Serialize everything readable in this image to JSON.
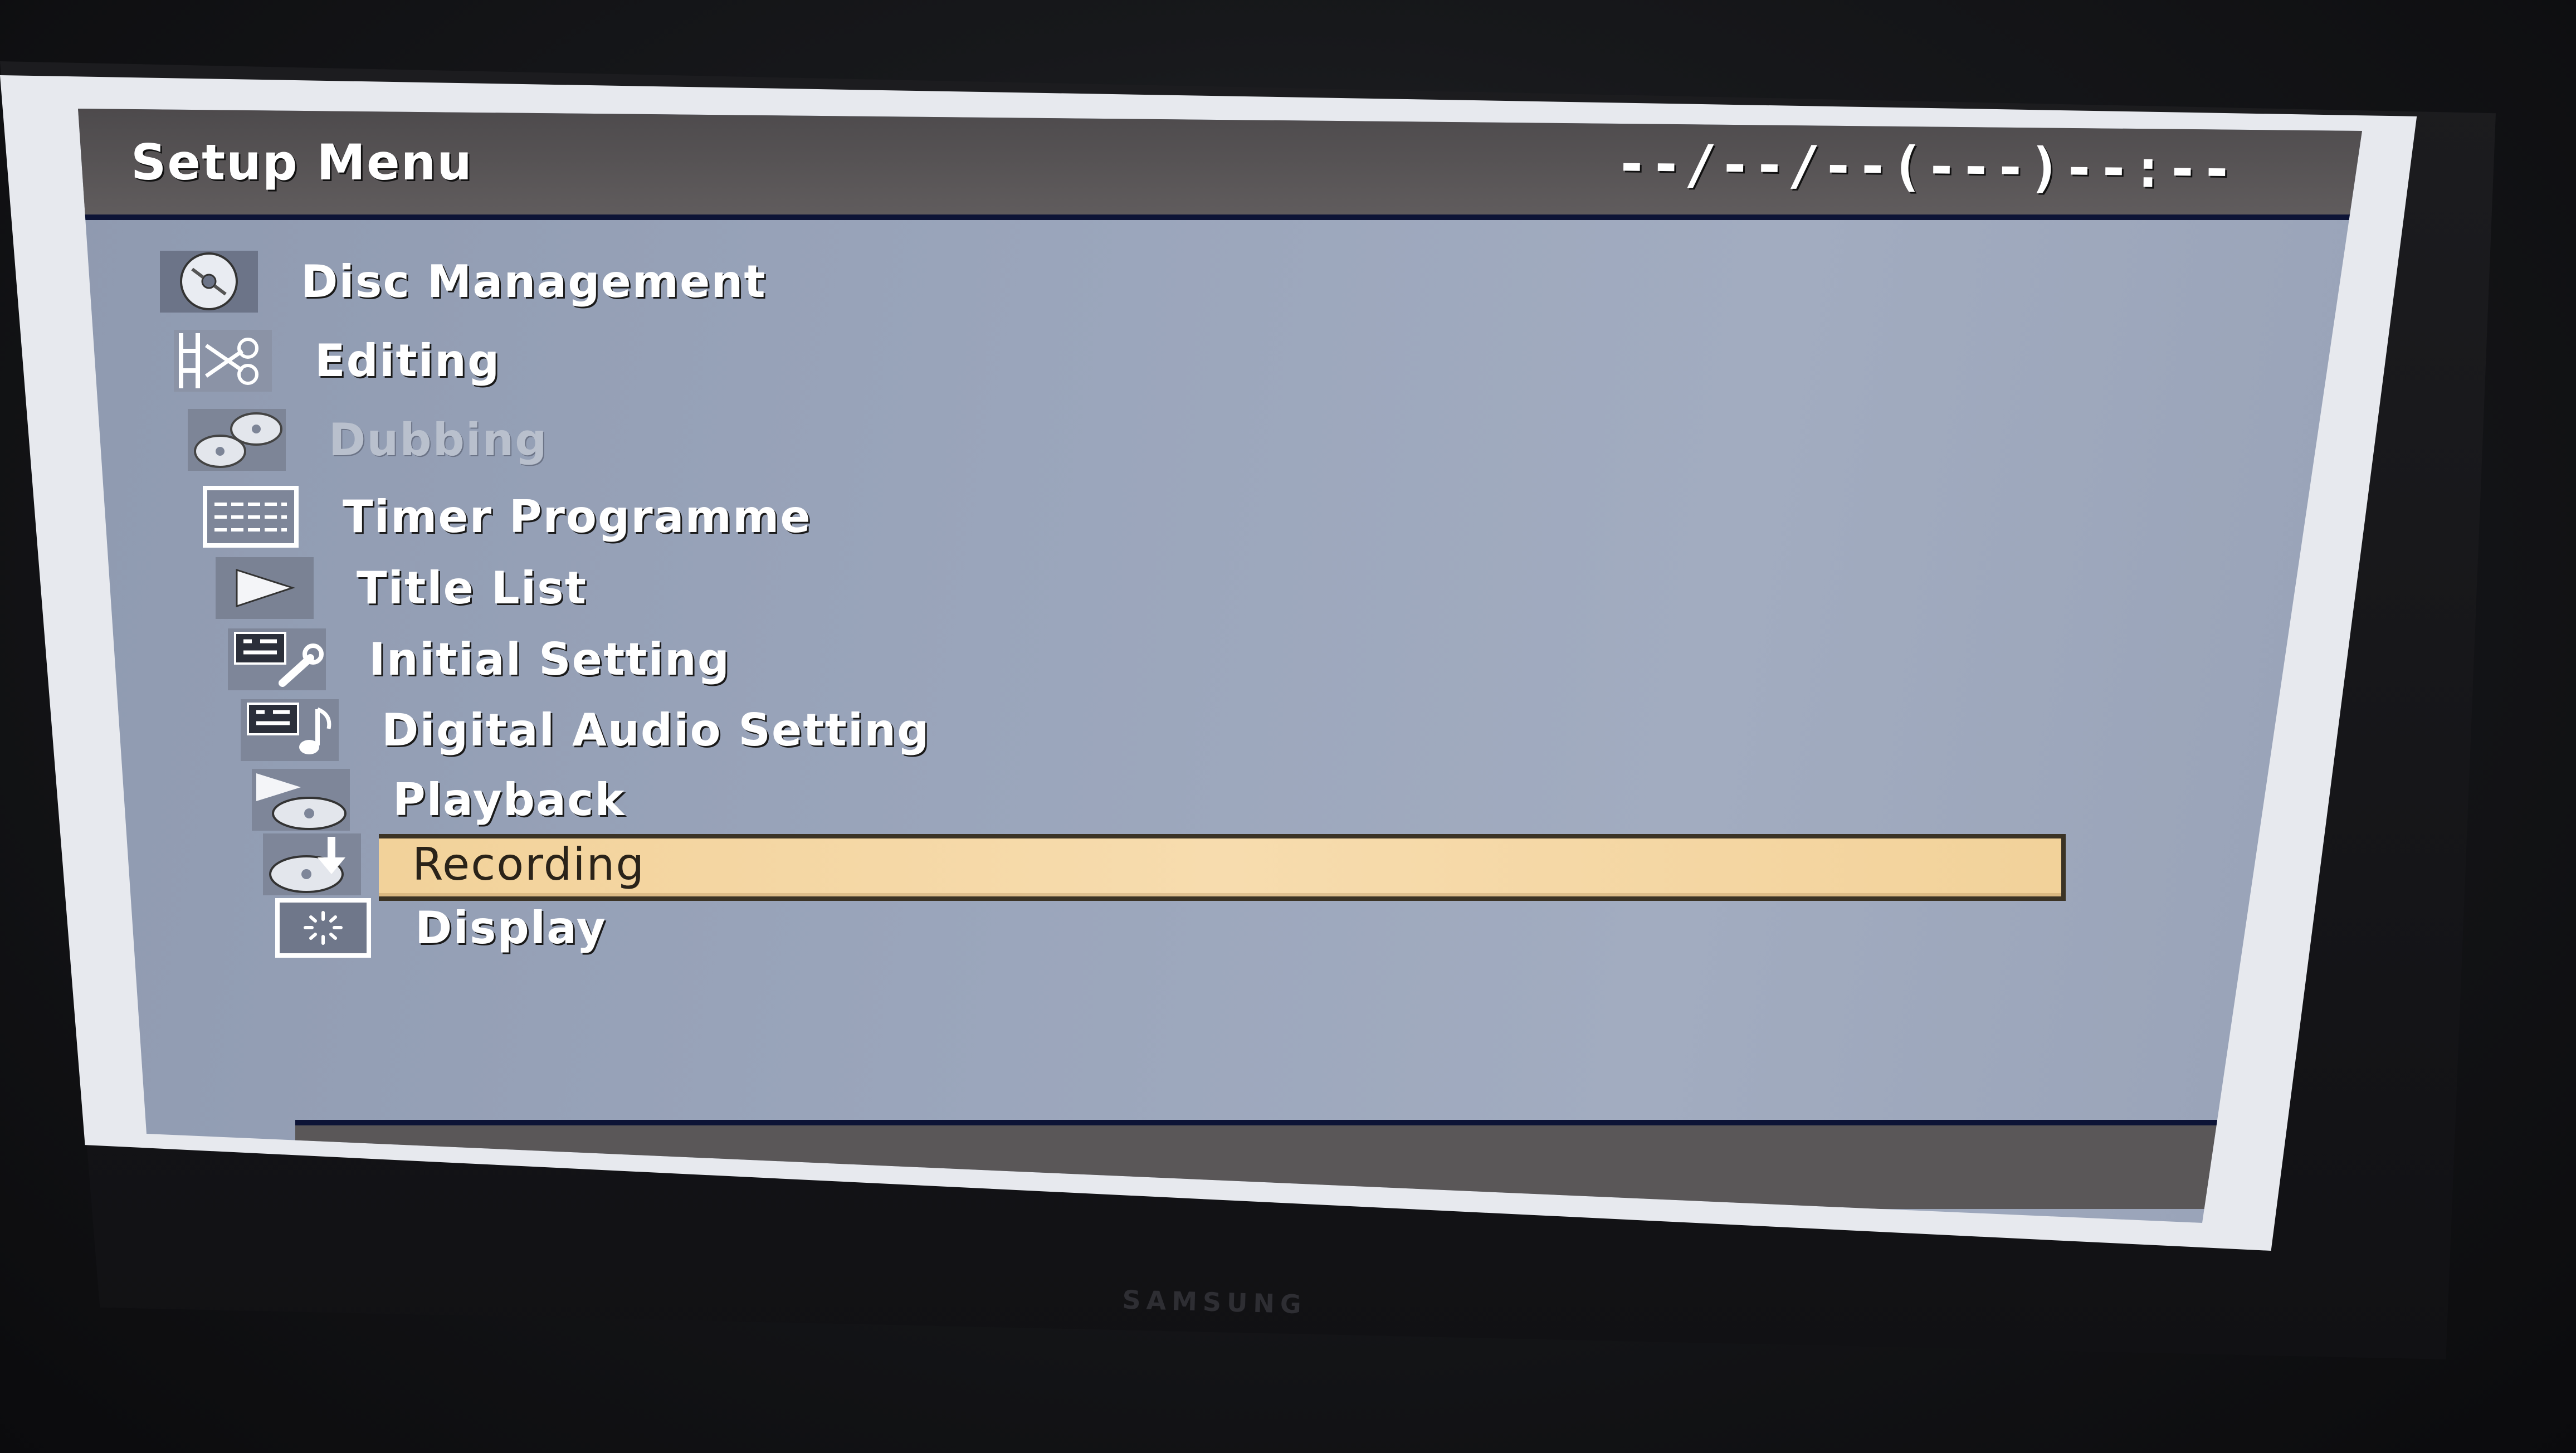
{
  "window": {
    "title": "Setup Menu",
    "datetime": "--/--/--(---)--:--"
  },
  "menu": {
    "items": [
      {
        "label": "Disc Management",
        "icon": "disc-icon",
        "state": "normal"
      },
      {
        "label": "Editing",
        "icon": "film-scissors-icon",
        "state": "normal"
      },
      {
        "label": "Dubbing",
        "icon": "dubbing-discs-icon",
        "state": "disabled"
      },
      {
        "label": "Timer Programme",
        "icon": "timer-list-icon",
        "state": "normal"
      },
      {
        "label": "Title List",
        "icon": "play-icon",
        "state": "normal"
      },
      {
        "label": "Initial Setting",
        "icon": "wrench-settings-icon",
        "state": "normal"
      },
      {
        "label": "Digital Audio Setting",
        "icon": "music-note-icon",
        "state": "normal"
      },
      {
        "label": "Playback",
        "icon": "playback-disc-icon",
        "state": "normal"
      },
      {
        "label": "Recording",
        "icon": "recording-disc-icon",
        "state": "selected"
      },
      {
        "label": "Display",
        "icon": "display-icon",
        "state": "normal"
      }
    ]
  },
  "tv": {
    "brand": "SAMSUNG"
  },
  "colors": {
    "panel": "#9aa5bb",
    "title_bar": "#4d4a4c",
    "highlight": "#f2d29a",
    "text": "#ffffff",
    "disabled_text": "#b9c0cd"
  }
}
